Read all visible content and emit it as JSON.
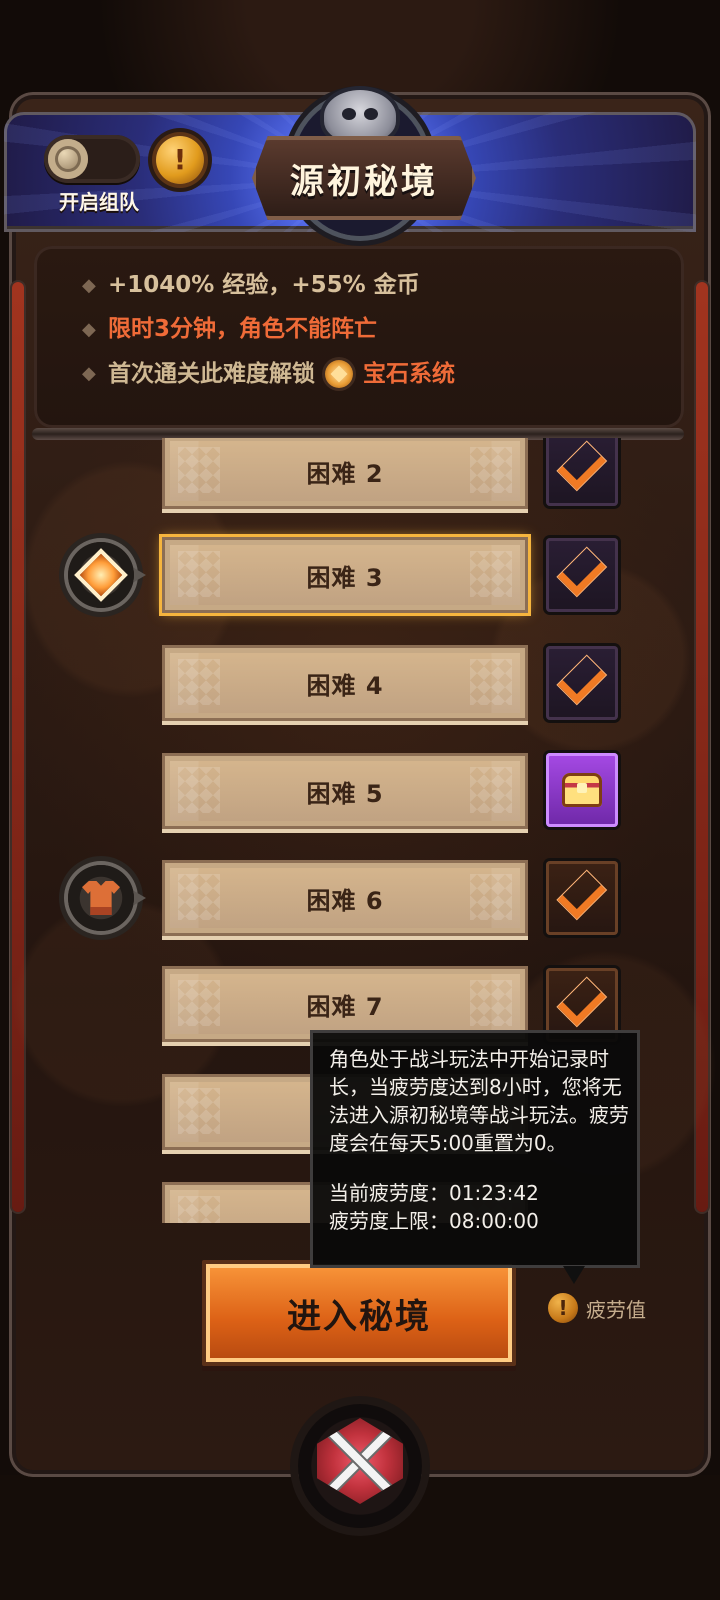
{
  "header": {
    "title": "源初秘境",
    "team_toggle_label": "开启组队"
  },
  "info": {
    "lines": [
      "+1040% 经验，+55% 金币",
      "限时3分钟，角色不能阵亡",
      "首次通关此难度解锁"
    ],
    "unlock_reward": "宝石系统"
  },
  "difficulty_list": [
    {
      "label": "困难 2",
      "reward_icon": "check-icon",
      "selected": false
    },
    {
      "label": "困难 3",
      "reward_icon": "check-icon",
      "selected": true,
      "unlock_icon": "gem-icon"
    },
    {
      "label": "困难 4",
      "reward_icon": "check-icon",
      "selected": false
    },
    {
      "label": "困难 5",
      "reward_icon": "chest-icon",
      "selected": false
    },
    {
      "label": "困难 6",
      "reward_icon": "check-icon",
      "selected": false,
      "unlock_icon": "shirt-icon"
    },
    {
      "label": "困难 7",
      "reward_icon": "check-icon",
      "selected": false
    },
    {
      "label": "",
      "reward_icon": "",
      "selected": false
    },
    {
      "label": "",
      "reward_icon": "",
      "selected": false
    }
  ],
  "tooltip": {
    "description": "角色处于战斗玩法中开始记录时长，当疲劳度达到8小时，您将无法进入源初秘境等战斗玩法。疲劳度会在每天5:00重置为0。",
    "current_label": "当前疲劳度：",
    "current_value": "01:23:42",
    "limit_label": "疲劳度上限：",
    "limit_value": "08:00:00"
  },
  "actions": {
    "enter_label": "进入秘境",
    "fatigue_label": "疲劳值"
  },
  "colors": {
    "accent_orange": "#e46a1d",
    "selected_border": "#f6b53e",
    "warning_text": "#ef6b38"
  }
}
